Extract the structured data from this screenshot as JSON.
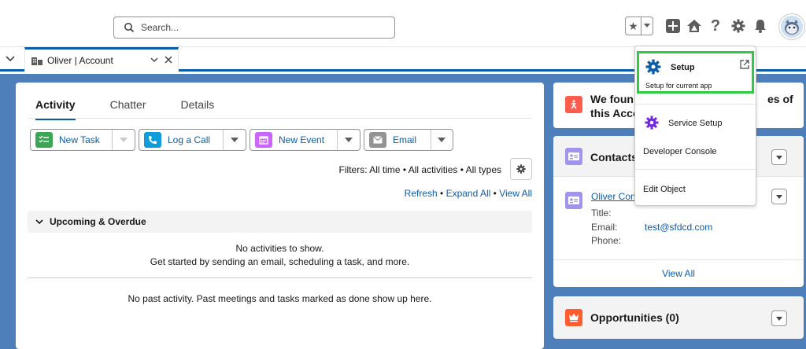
{
  "search": {
    "placeholder": "Search..."
  },
  "header_icons": [
    "star-icon",
    "add-icon",
    "trailhead-icon",
    "help-icon",
    "setup-gear-icon",
    "bell-icon",
    "avatar"
  ],
  "tab": {
    "label": "Oliver | Account"
  },
  "activity": {
    "tabs": [
      "Activity",
      "Chatter",
      "Details"
    ],
    "buttons": {
      "new_task": "New Task",
      "log_call": "Log a Call",
      "new_event": "New Event",
      "email": "Email"
    },
    "filters": "Filters: All time • All activities • All types",
    "links": {
      "refresh": "Refresh",
      "expand_all": "Expand All",
      "view_all": "View All",
      "sep": "•"
    },
    "upcoming_title": "Upcoming & Overdue",
    "empty_line1": "No activities to show.",
    "empty_line2": "Get started by sending an email, scheduling a task, and more.",
    "past_empty": "No past activity. Past meetings and tasks marked as done show up here."
  },
  "right": {
    "found_line1": "We foun",
    "found_line1_end": "es of",
    "found_line2": "this Acco",
    "contacts_title": "Contacts",
    "contact": {
      "name": "Oliver Con",
      "title_label": "Title:",
      "email_label": "Email:",
      "email_value": "test@sfdcd.com",
      "phone_label": "Phone:"
    },
    "view_all": "View All",
    "opportunities_title": "Opportunities (0)"
  },
  "menu": {
    "setup": "Setup",
    "setup_sub": "Setup for current app",
    "service_setup": "Service Setup",
    "developer_console": "Developer Console",
    "edit_object": "Edit Object"
  },
  "colors": {
    "brand_blue": "#0b5cab",
    "bg_blue": "#4e7fbb",
    "task_green": "#3ba755",
    "call_teal": "#0d9dda",
    "event_purple": "#cb65ff",
    "email_gray": "#939393",
    "highlight_green": "#2ecc40",
    "setup_purple": "#7526e3",
    "orange": "#fe5c4c"
  }
}
